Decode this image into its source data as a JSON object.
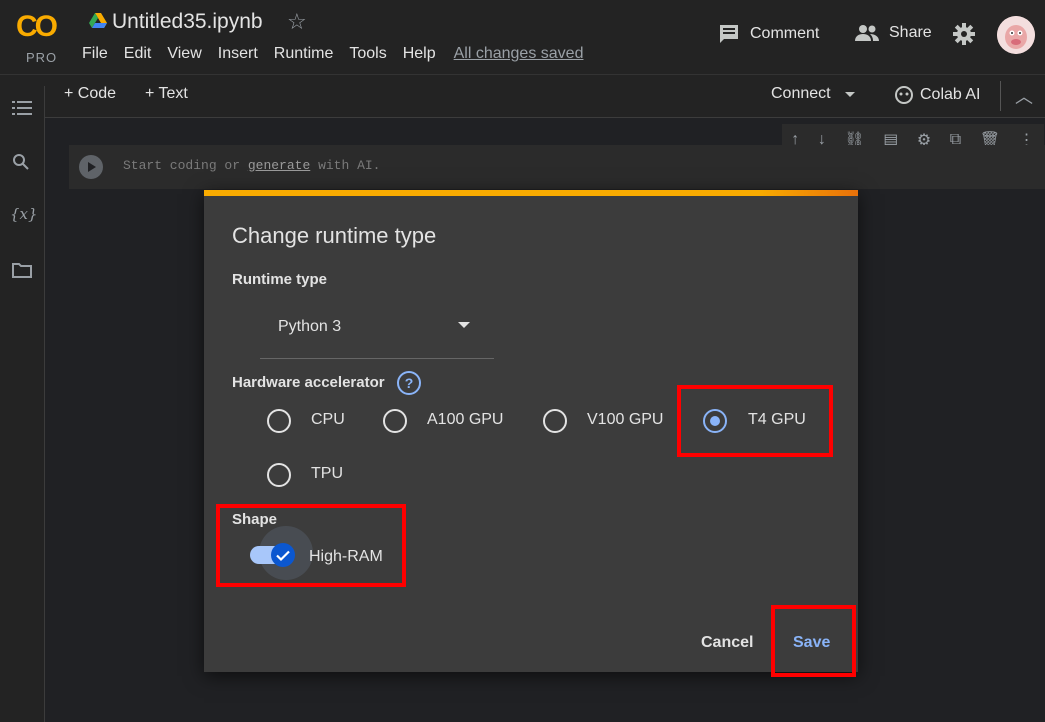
{
  "app": {
    "logo_text": "CO",
    "plan": "PRO",
    "notebook_title": "Untitled35.ipynb",
    "save_status": "All changes saved"
  },
  "menu": [
    "File",
    "Edit",
    "View",
    "Insert",
    "Runtime",
    "Tools",
    "Help"
  ],
  "header_actions": {
    "comment_label": "Comment",
    "share_label": "Share"
  },
  "toolbar": {
    "add_code_label": "+ Code",
    "add_text_label": "+ Text",
    "connect_label": "Connect",
    "colab_ai_label": "Colab AI"
  },
  "sidebar_icons": [
    "toc-icon",
    "search-icon",
    "variables-icon",
    "folder-icon"
  ],
  "cell": {
    "placeholder_prefix": "Start coding or",
    "placeholder_link": "generate",
    "placeholder_suffix": "with AI."
  },
  "dialog": {
    "title": "Change runtime type",
    "runtime_type_label": "Runtime type",
    "runtime_type_value": "Python 3",
    "hardware_label": "Hardware accelerator",
    "help_glyph": "?",
    "accelerators": [
      {
        "label": "CPU",
        "selected": false
      },
      {
        "label": "A100 GPU",
        "selected": false
      },
      {
        "label": "V100 GPU",
        "selected": false
      },
      {
        "label": "T4 GPU",
        "selected": true
      },
      {
        "label": "TPU",
        "selected": false
      }
    ],
    "shape_label": "Shape",
    "high_ram_label": "High-RAM",
    "high_ram_enabled": true,
    "cancel_label": "Cancel",
    "save_label": "Save"
  },
  "colors": {
    "accent": "#8ab4f8",
    "brand": "#f9ab00",
    "highlight": "#ff0000"
  }
}
